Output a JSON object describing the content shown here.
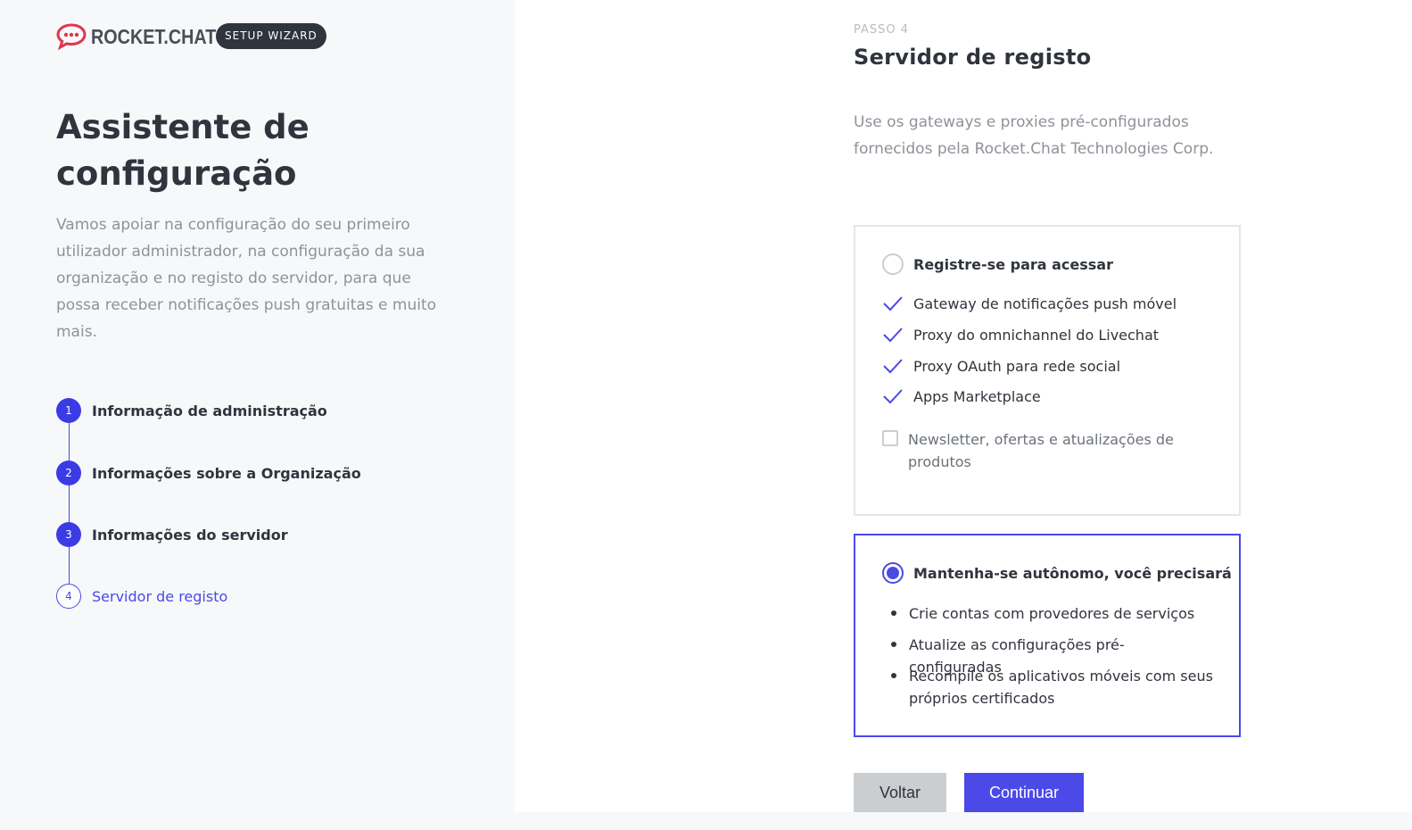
{
  "brand": {
    "logo_text": "ROCKET.CHAT",
    "badge": "SETUP WIZARD",
    "accent_color": "#4b49e8",
    "logo_color": "#e0364d"
  },
  "sidebar": {
    "title": "Assistente de configuração",
    "description": "Vamos apoiar na configuração do seu primeiro utilizador administrador, na configuração da sua organização e no registo do servidor, para que possa receber notificações push gratuitas e muito mais.",
    "steps": [
      {
        "number": "1",
        "label": "Informação de administração",
        "state": "done"
      },
      {
        "number": "2",
        "label": "Informações sobre a Organização",
        "state": "done"
      },
      {
        "number": "3",
        "label": "Informações do servidor",
        "state": "done"
      },
      {
        "number": "4",
        "label": "Servidor de registo",
        "state": "current"
      }
    ]
  },
  "main": {
    "step_caption": "PASSO 4",
    "title": "Servidor de registo",
    "intro": "Use os gateways e proxies pré-configurados fornecidos pela Rocket.Chat Technologies Corp.",
    "option_register": {
      "title": "Registre-se para acessar",
      "selected": false,
      "features": [
        "Gateway de notificações push móvel",
        "Proxy do omnichannel do Livechat",
        "Proxy OAuth para rede social",
        "Apps Marketplace"
      ],
      "newsletter_label": "Newsletter, ofertas e atualizações de produtos",
      "newsletter_checked": false
    },
    "option_standalone": {
      "title": "Mantenha-se autônomo, você precisará",
      "selected": true,
      "bullets": [
        "Crie contas com provedores de serviços",
        "Atualize as configurações pré-configuradas",
        "Recompile os aplicativos móveis com seus próprios certificados"
      ]
    },
    "buttons": {
      "back": "Voltar",
      "continue": "Continuar"
    }
  }
}
